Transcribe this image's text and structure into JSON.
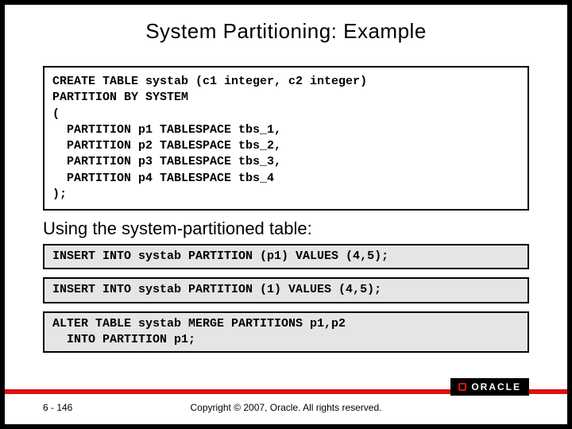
{
  "title": "System Partitioning: Example",
  "code_main": "CREATE TABLE systab (c1 integer, c2 integer)\nPARTITION BY SYSTEM\n(\n  PARTITION p1 TABLESPACE tbs_1,\n  PARTITION p2 TABLESPACE tbs_2,\n  PARTITION p3 TABLESPACE tbs_3,\n  PARTITION p4 TABLESPACE tbs_4\n);",
  "subtitle": "Using the system-partitioned table:",
  "code_insert1": "INSERT INTO systab PARTITION (p1) VALUES (4,5);",
  "code_insert2": "INSERT INTO systab PARTITION (1) VALUES (4,5);",
  "code_alter": "ALTER TABLE systab MERGE PARTITIONS p1,p2\n  INTO PARTITION p1;",
  "footer": {
    "page": "6 - 146",
    "copyright": "Copyright © 2007, Oracle. All rights reserved."
  },
  "logo_text": "ORACLE"
}
